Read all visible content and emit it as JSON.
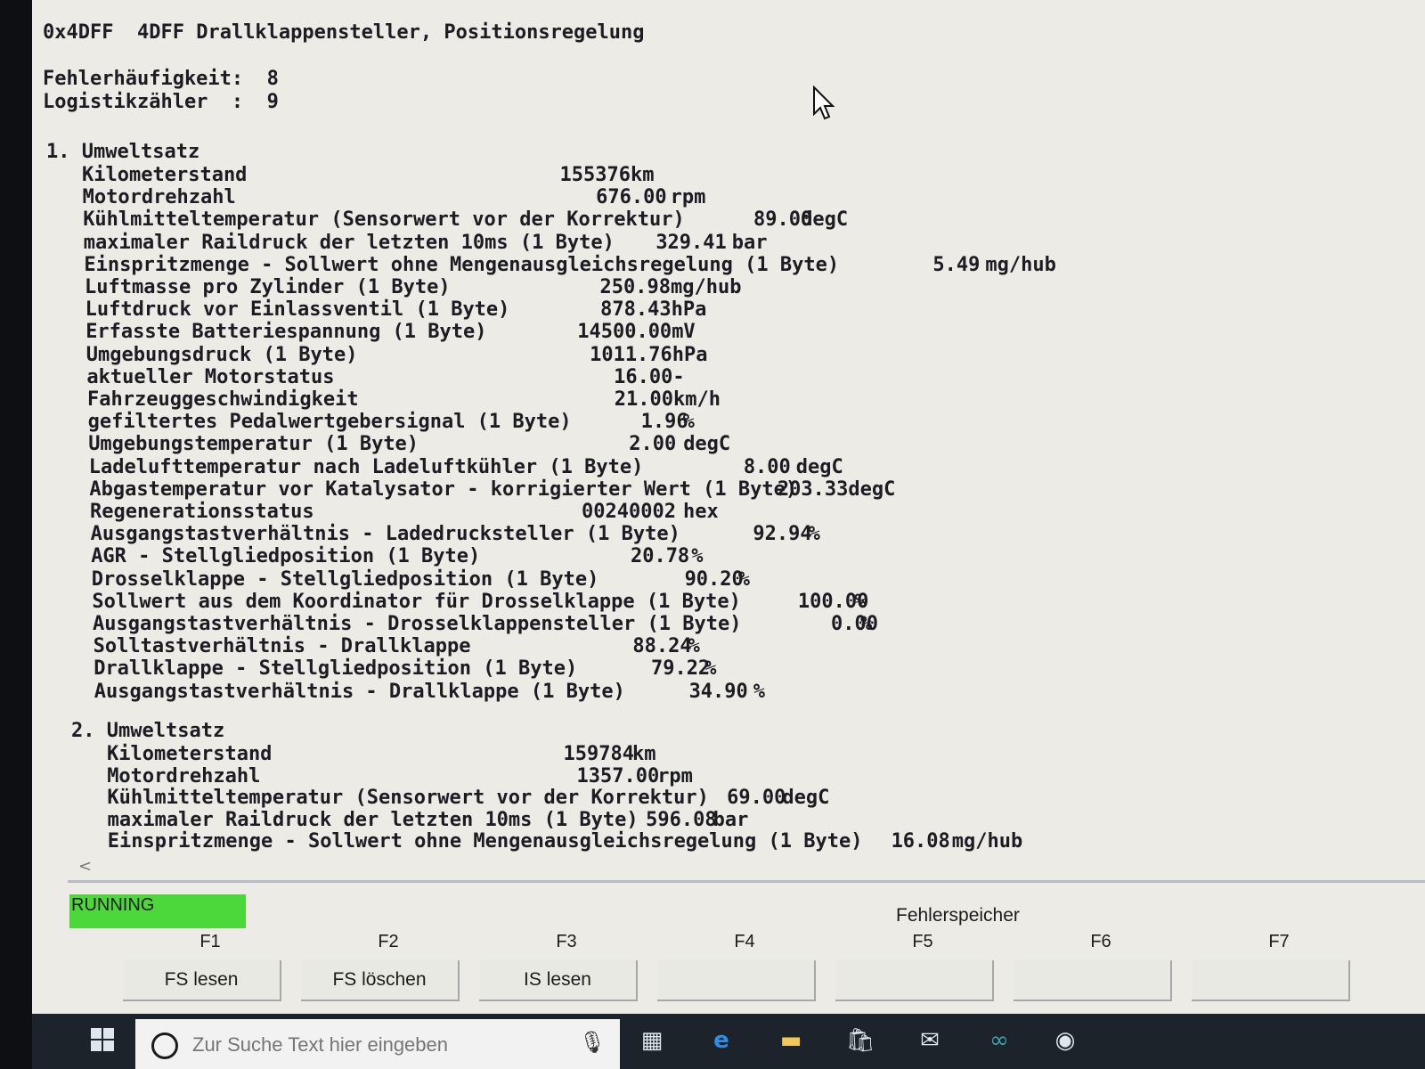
{
  "header": {
    "code": "0x4DFF",
    "title": "4DFF Drallklappensteller, Positionsregelung"
  },
  "meta": [
    {
      "label": "Fehlerhäufigkeit:",
      "value": "8"
    },
    {
      "label": "Logistikzähler  :",
      "value": "9"
    }
  ],
  "sections": [
    {
      "title": "1. Umweltsatz",
      "rows": [
        {
          "label": "Kilometerstand",
          "value": "155376",
          "unit": "km"
        },
        {
          "label": "Motordrehzahl",
          "value": "676.00",
          "unit": "rpm"
        },
        {
          "label": "Kühlmitteltemperatur (Sensorwert vor der Korrektur)",
          "value": "89.00",
          "unit": "degC"
        },
        {
          "label": "maximaler Raildruck der letzten 10ms (1 Byte)",
          "value": "329.41",
          "unit": "bar"
        },
        {
          "label": "Einspritzmenge - Sollwert ohne Mengenausgleichsregelung (1 Byte)",
          "value": "5.49",
          "unit": "mg/hub"
        },
        {
          "label": "Luftmasse pro Zylinder (1 Byte)",
          "value": "250.98",
          "unit": "mg/hub"
        },
        {
          "label": "Luftdruck vor Einlassventil (1 Byte)",
          "value": "878.43",
          "unit": "hPa"
        },
        {
          "label": "Erfasste Batteriespannung (1 Byte)",
          "value": "14500.00",
          "unit": "mV"
        },
        {
          "label": "Umgebungsdruck (1 Byte)",
          "value": "1011.76",
          "unit": "hPa"
        },
        {
          "label": "aktueller Motorstatus",
          "value": "16.00",
          "unit": "-"
        },
        {
          "label": "Fahrzeuggeschwindigkeit",
          "value": "21.00",
          "unit": "km/h"
        },
        {
          "label": "gefiltertes Pedalwertgebersignal (1 Byte)",
          "value": "1.96",
          "unit": "%"
        },
        {
          "label": "Umgebungstemperatur (1 Byte)",
          "value": "2.00",
          "unit": "degC"
        },
        {
          "label": "Ladelufttemperatur nach Ladeluftkühler (1 Byte)",
          "value": "8.00",
          "unit": "degC"
        },
        {
          "label": "Abgastemperatur vor Katalysator - korrigierter Wert (1 Byte)",
          "value": "203.33",
          "unit": "degC"
        },
        {
          "label": "Regenerationsstatus",
          "value": "00240002",
          "unit": "hex"
        },
        {
          "label": "Ausgangstastverhältnis - Ladedrucksteller (1 Byte)",
          "value": "92.94",
          "unit": "%"
        },
        {
          "label": "AGR - Stellgliedposition (1 Byte)",
          "value": "20.78",
          "unit": "%"
        },
        {
          "label": "Drosselklappe - Stellgliedposition (1 Byte)",
          "value": "90.20",
          "unit": "%"
        },
        {
          "label": "Sollwert aus dem Koordinator für Drosselklappe (1 Byte)",
          "value": "100.00",
          "unit": "%"
        },
        {
          "label": "Ausgangstastverhältnis - Drosselklappensteller (1 Byte)",
          "value": "0.00",
          "unit": "%"
        },
        {
          "label": "Solltastverhältnis - Drallklappe",
          "value": "88.24",
          "unit": "%"
        },
        {
          "label": "Drallklappe - Stellgliedposition (1 Byte)",
          "value": "79.22",
          "unit": "%"
        },
        {
          "label": "Ausgangstastverhältnis - Drallklappe (1 Byte)",
          "value": "34.90",
          "unit": "%"
        }
      ]
    },
    {
      "title": "2. Umweltsatz",
      "rows": [
        {
          "label": "Kilometerstand",
          "value": "159784",
          "unit": "km"
        },
        {
          "label": "Motordrehzahl",
          "value": "1357.00",
          "unit": "rpm"
        },
        {
          "label": "Kühlmitteltemperatur (Sensorwert vor der Korrektur)",
          "value": "69.00",
          "unit": "degC"
        },
        {
          "label": "maximaler Raildruck der letzten 10ms (1 Byte)",
          "value": "596.08",
          "unit": "bar"
        },
        {
          "label": "Einspritzmenge - Sollwert ohne Mengenausgleichsregelung (1 Byte)",
          "value": "16.08",
          "unit": "mg/hub"
        }
      ]
    }
  ],
  "scroll_hint": "<",
  "status": {
    "text": "RUNNING",
    "color": "#4cd83a"
  },
  "panel_title": "Fehlerspeicher",
  "function_keys": [
    {
      "key": "F1",
      "label": "FS lesen"
    },
    {
      "key": "F2",
      "label": "FS löschen"
    },
    {
      "key": "F3",
      "label": "IS lesen"
    },
    {
      "key": "F4",
      "label": ""
    },
    {
      "key": "F5",
      "label": ""
    },
    {
      "key": "F6",
      "label": ""
    },
    {
      "key": "F7",
      "label": ""
    }
  ],
  "taskbar": {
    "search_placeholder": "Zur Suche Text hier eingeben",
    "icons": [
      "windows-start-icon",
      "task-view-icon",
      "edge-browser-icon",
      "file-explorer-icon",
      "store-icon",
      "mail-icon",
      "arduino-icon",
      "bmw-icon"
    ]
  }
}
